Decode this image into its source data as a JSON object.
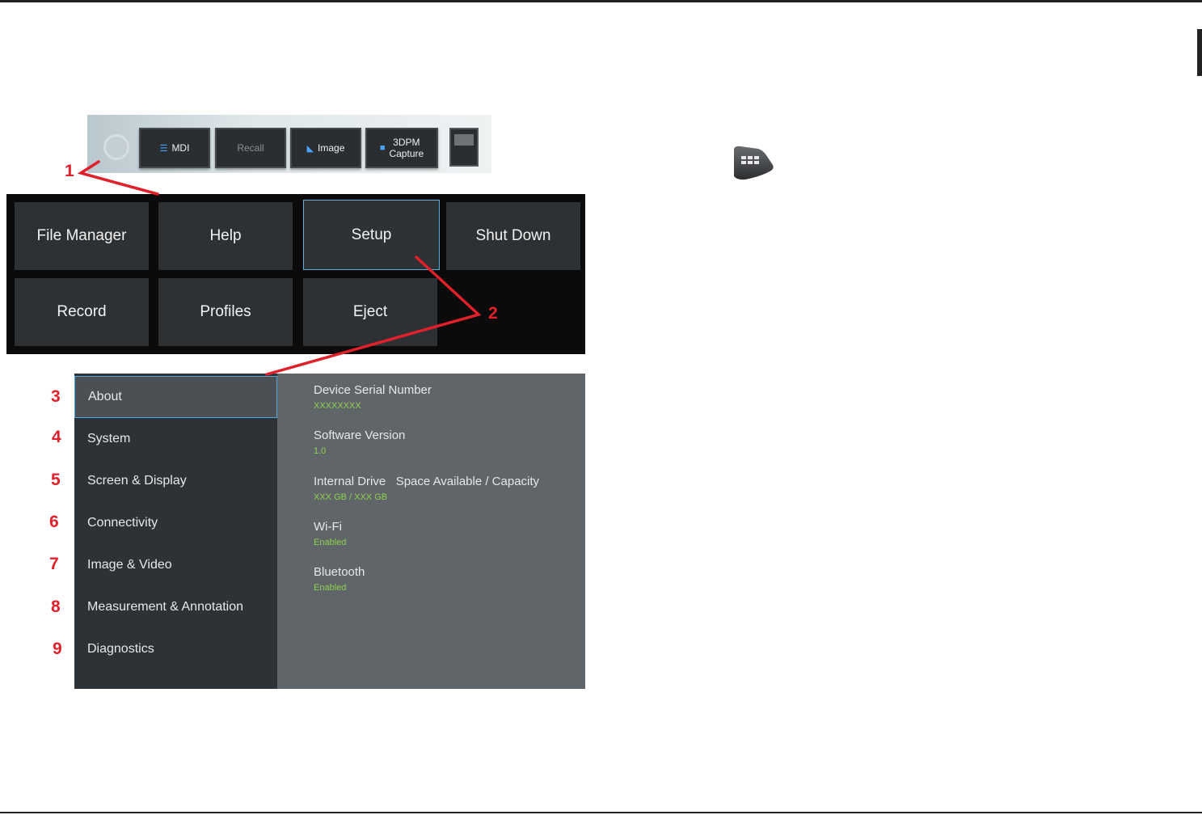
{
  "toolbar": {
    "buttons": [
      {
        "label": "MDI",
        "icon": "list-icon"
      },
      {
        "label": "Recall",
        "icon": ""
      },
      {
        "label": "Image",
        "icon": "image-icon"
      },
      {
        "label_line1": "3DPM",
        "label_line2": "Capture",
        "icon": "camera-icon"
      }
    ]
  },
  "main_menu": {
    "tiles": [
      {
        "label": "File Manager"
      },
      {
        "label": "Help"
      },
      {
        "label": "Setup"
      },
      {
        "label": "Shut Down"
      },
      {
        "label": "Record"
      },
      {
        "label": "Profiles"
      },
      {
        "label": "Eject"
      }
    ],
    "selected": "Setup"
  },
  "settings": {
    "menu": [
      {
        "label": "About"
      },
      {
        "label": "System"
      },
      {
        "label": "Screen & Display"
      },
      {
        "label": "Connectivity"
      },
      {
        "label": "Image & Video"
      },
      {
        "label": "Measurement & Annotation"
      },
      {
        "label": "Diagnostics"
      }
    ],
    "selected": "About",
    "info": [
      {
        "label": "Device Serial Number",
        "value": "XXXXXXXX"
      },
      {
        "label": "Software Version",
        "value": "1.0"
      },
      {
        "label": "Internal Drive   Space Available / Capacity",
        "value": "XXX GB / XXX GB"
      },
      {
        "label": "Wi-Fi",
        "value": "Enabled"
      },
      {
        "label": "Bluetooth",
        "value": "Enabled"
      }
    ]
  },
  "callouts": [
    "1",
    "2",
    "3",
    "4",
    "5",
    "6",
    "7",
    "8",
    "9"
  ],
  "colors": {
    "callout_red": "#e0202a",
    "selection_blue": "#4fa8dc",
    "value_green": "#8fd14f"
  },
  "icons": {
    "menu_key": "grid-menu-key-icon"
  }
}
